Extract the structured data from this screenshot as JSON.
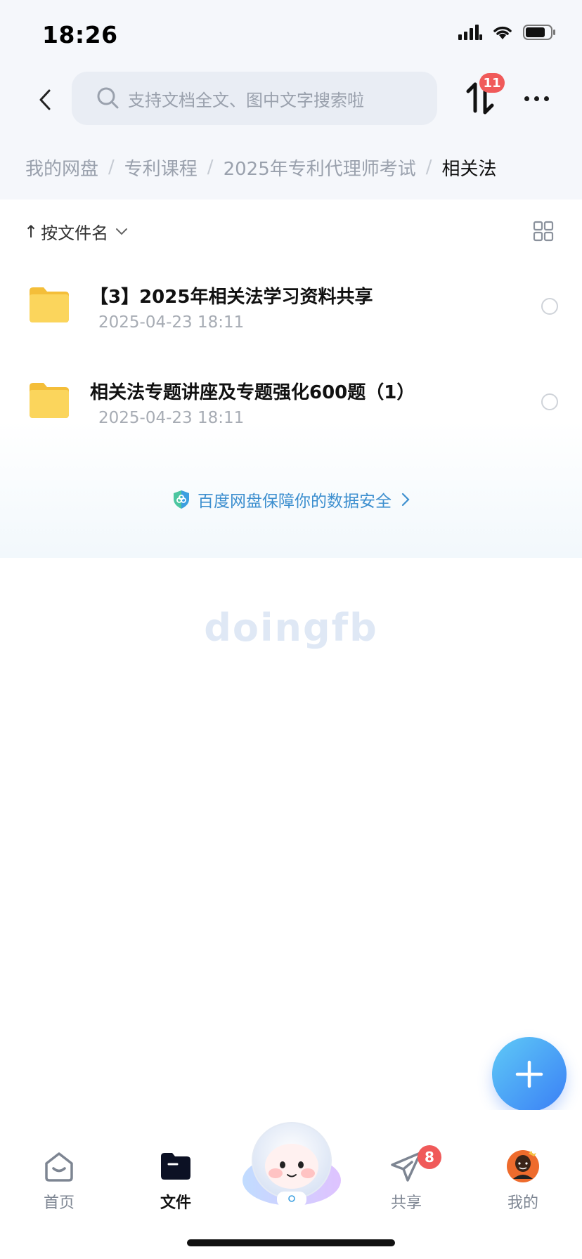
{
  "status_bar": {
    "time": "18:26"
  },
  "header": {
    "search_placeholder": "支持文档全文、图中文字搜索啦",
    "transfer_badge": "11"
  },
  "breadcrumb": {
    "items": [
      "我的网盘",
      "专利课程",
      "2025年专利代理师考试"
    ],
    "current": "相关法"
  },
  "toolbar": {
    "sort_label": "按文件名",
    "sort_arrow": "↑"
  },
  "files": [
    {
      "name": "【3】2025年相关法学习资料共享",
      "date": "2025-04-23 18:11"
    },
    {
      "name": "相关法专题讲座及专题强化600题（1）",
      "date": "2025-04-23 18:11"
    }
  ],
  "security_link": "百度网盘保障你的数据安全",
  "watermark": "doingfb",
  "tabs": [
    {
      "label": "首页",
      "icon": "home-icon"
    },
    {
      "label": "文件",
      "icon": "folder-icon"
    },
    {
      "label": "共享",
      "icon": "share-plane-icon",
      "badge": "8"
    },
    {
      "label": "我的",
      "icon": "avatar"
    }
  ],
  "colors": {
    "accent": "#3a7ff5",
    "badge": "#f05a5a",
    "folder": "#f9cd4c",
    "link": "#3d8fcf"
  }
}
